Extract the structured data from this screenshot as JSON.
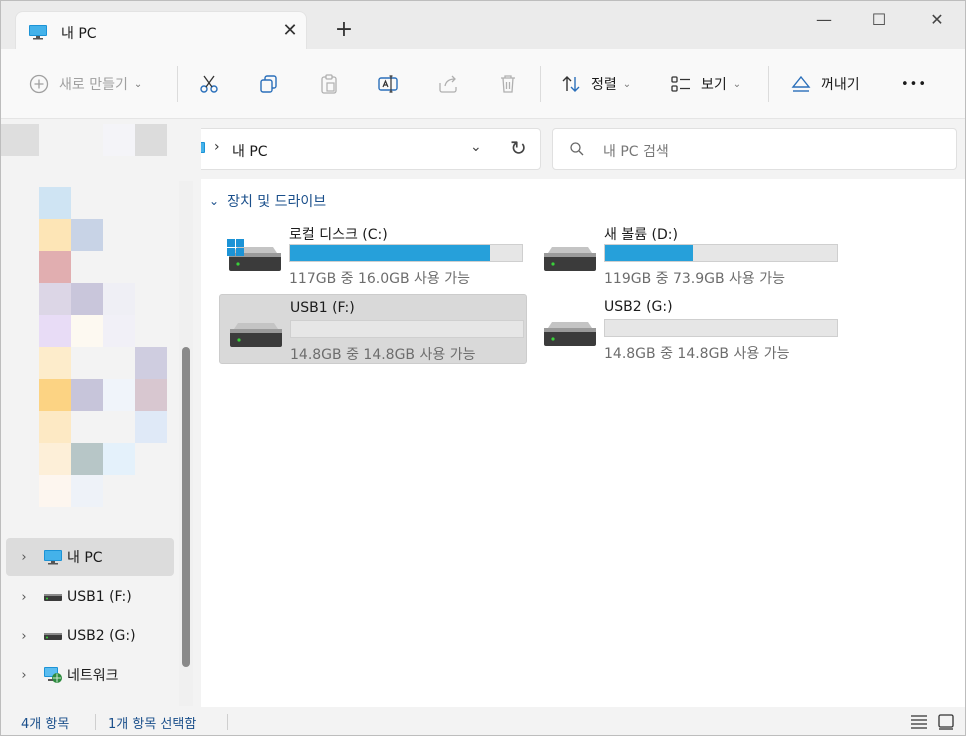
{
  "tab": {
    "title": "내 PC",
    "close_glyph": "✕",
    "new_glyph": "+"
  },
  "window_controls": {
    "minimize": "—",
    "maximize": "☐",
    "close": "✕"
  },
  "toolbar": {
    "new_label": "새로 만들기",
    "sort_label": "정렬",
    "view_label": "보기",
    "eject_label": "꺼내기",
    "more_glyph": "•••",
    "chevron": "⌄"
  },
  "address": {
    "separator": "›",
    "path": "내 PC",
    "dropdown": "⌄",
    "refresh": "↻"
  },
  "search": {
    "placeholder": "내 PC 검색"
  },
  "group": {
    "title": "장치 및 드라이브",
    "chevron": "⌄"
  },
  "drives": [
    {
      "name": "로컬 디스크 (C:)",
      "free_text": "117GB 중 16.0GB 사용 가능",
      "used_fraction": 0.86,
      "icon": "windows-drive-icon",
      "selected": false
    },
    {
      "name": "새 볼륨 (D:)",
      "free_text": "119GB 중 73.9GB 사용 가능",
      "used_fraction": 0.38,
      "icon": "drive-icon",
      "selected": false
    },
    {
      "name": "USB1 (F:)",
      "free_text": "14.8GB 중 14.8GB 사용 가능",
      "used_fraction": 0.0,
      "icon": "drive-icon",
      "selected": true
    },
    {
      "name": "USB2 (G:)",
      "free_text": "14.8GB 중 14.8GB 사용 가능",
      "used_fraction": 0.0,
      "icon": "drive-icon",
      "selected": false
    }
  ],
  "nav": {
    "expand_glyph": "›",
    "items": [
      {
        "label": "내 PC",
        "icon": "pc-icon",
        "selected": true
      },
      {
        "label": "USB1 (F:)",
        "icon": "usb-drive-icon",
        "selected": false
      },
      {
        "label": "USB2 (G:)",
        "icon": "usb-drive-icon",
        "selected": false
      },
      {
        "label": "네트워크",
        "icon": "network-icon",
        "selected": false
      }
    ]
  },
  "status": {
    "item_count": "4개 항목",
    "selection": "1개 항목 선택함"
  },
  "colors": {
    "accent": "#26a0da",
    "status_text": "#1a4f8b"
  }
}
